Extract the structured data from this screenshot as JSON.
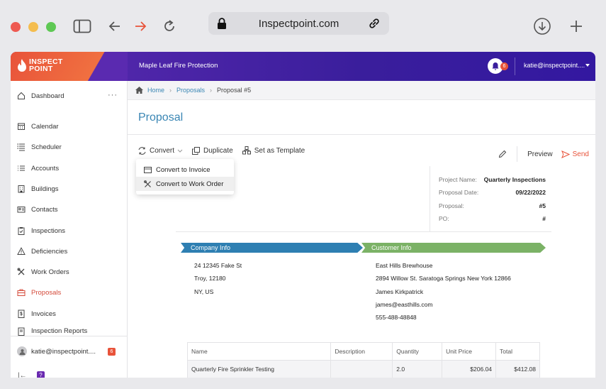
{
  "browser": {
    "url": "Inspectpoint.com"
  },
  "header": {
    "logo_line1": "INSPECT",
    "logo_line2": "POINT",
    "company_name": "Maple Leaf Fire Protection",
    "notification_count": "6",
    "user_email": "katie@inspectpoint...."
  },
  "sidebar": {
    "items": [
      {
        "label": "Dashboard",
        "icon": "home-icon"
      },
      {
        "label": "Calendar",
        "icon": "calendar-icon"
      },
      {
        "label": "Scheduler",
        "icon": "scheduler-icon"
      },
      {
        "label": "Accounts",
        "icon": "list-icon"
      },
      {
        "label": "Buildings",
        "icon": "building-icon"
      },
      {
        "label": "Contacts",
        "icon": "contact-card-icon"
      },
      {
        "label": "Inspections",
        "icon": "clipboard-check-icon"
      },
      {
        "label": "Deficiencies",
        "icon": "warning-icon"
      },
      {
        "label": "Work Orders",
        "icon": "tools-icon"
      },
      {
        "label": "Proposals",
        "icon": "briefcase-icon"
      },
      {
        "label": "Invoices",
        "icon": "dollar-doc-icon"
      },
      {
        "label": "Inspection Reports",
        "icon": "report-icon"
      }
    ],
    "user_email": "katie@inspectpoint....",
    "user_badge": "6"
  },
  "breadcrumb": {
    "home": "Home",
    "proposals": "Proposals",
    "current": "Proposal #5"
  },
  "page": {
    "title": "Proposal"
  },
  "toolbar": {
    "convert": "Convert",
    "duplicate": "Duplicate",
    "set_template": "Set as Template",
    "preview": "Preview",
    "send": "Send"
  },
  "convert_menu": {
    "invoice": "Convert to Invoice",
    "work_order": "Convert to Work Order"
  },
  "proposal_meta": {
    "project_name_label": "Project Name:",
    "project_name": "Quarterly Inspections",
    "date_label": "Proposal Date:",
    "date": "09/22/2022",
    "proposal_label": "Proposal:",
    "proposal": "#5",
    "po_label": "PO:",
    "po": "#"
  },
  "company_info": {
    "heading": "Company Info",
    "line1": "24 12345 Fake St",
    "line2": "Troy, 12180",
    "line3": "NY, US"
  },
  "customer_info": {
    "heading": "Customer Info",
    "name": "East Hills Brewhouse",
    "address": "2894 Willow St. Saratoga Springs New York 12866",
    "contact": "James Kirkpatrick",
    "email": "james@easthills.com",
    "phone": "555-488-48848"
  },
  "items_table": {
    "headers": [
      "Name",
      "Description",
      "Quantity",
      "Unit Price",
      "Total"
    ],
    "rows": [
      [
        "Quarterly Fire Sprinkler Testing",
        "",
        "2.0",
        "$206.04",
        "$412.08"
      ]
    ]
  }
}
